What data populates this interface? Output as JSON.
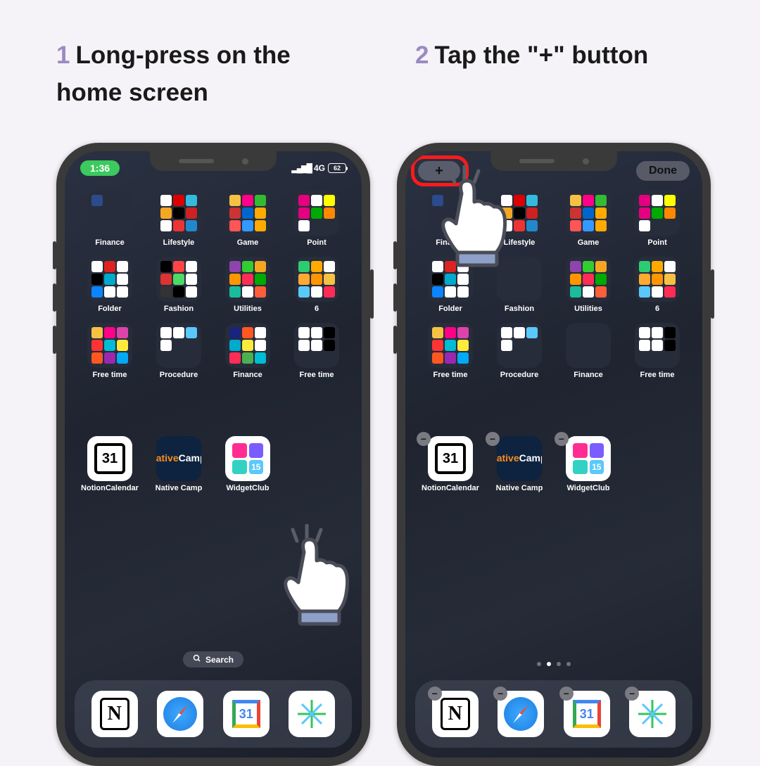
{
  "steps": [
    {
      "num": "1",
      "text": "Long-press on the home screen"
    },
    {
      "num": "2",
      "text": "Tap the \"+\" button"
    }
  ],
  "status": {
    "time": "1:36",
    "net": "4G",
    "battery": "62"
  },
  "editmode": {
    "plus": "+",
    "done": "Done"
  },
  "folders": [
    "Finance",
    "Lifestyle",
    "Game",
    "Point",
    "Folder",
    "Fashion",
    "Utilities",
    "6",
    "Free time",
    "Procedure",
    "Finance",
    "Free time"
  ],
  "apps": [
    {
      "label": "NotionCalendar"
    },
    {
      "label": "Native Camp"
    },
    {
      "label": "WidgetClub"
    }
  ],
  "search": "Search",
  "gcal_day": "31",
  "ncal_day": "31",
  "minus": "−"
}
